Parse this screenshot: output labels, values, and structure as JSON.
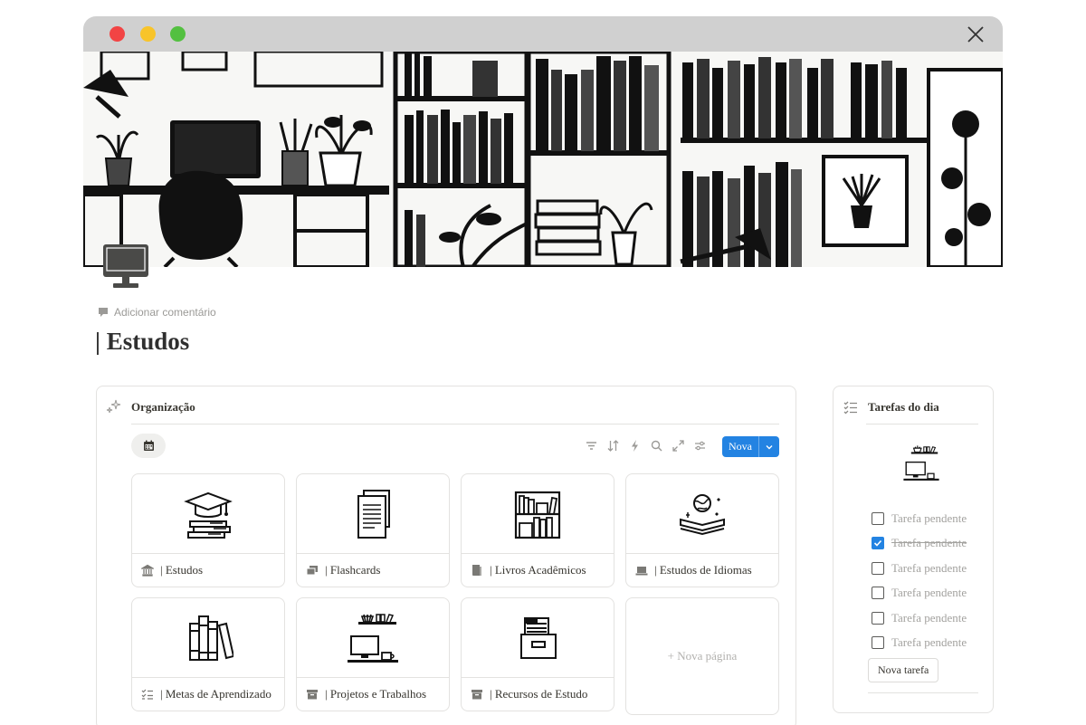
{
  "window": {
    "close_icon": "close-icon"
  },
  "page": {
    "add_comment_label": "Adicionar comentário",
    "title": "| Estudos"
  },
  "organization": {
    "title": "Organização",
    "new_button_label": "Nova",
    "cards": [
      {
        "label": "| Estudos",
        "icon": "bank-icon"
      },
      {
        "label": "| Flashcards",
        "icon": "cards-icon"
      },
      {
        "label": "| Livros Acadêmicos",
        "icon": "book-icon"
      },
      {
        "label": "| Estudos de Idiomas",
        "icon": "laptop-icon"
      },
      {
        "label": "| Metas de Aprendizado",
        "icon": "checklist-icon"
      },
      {
        "label": "| Projetos e Trabalhos",
        "icon": "archive-icon"
      },
      {
        "label": "| Recursos de Estudo",
        "icon": "archive-icon"
      }
    ],
    "new_page_label": "+ Nova página"
  },
  "tasks": {
    "title": "Tarefas do dia",
    "items": [
      {
        "text": "Tarefa pendente",
        "checked": false
      },
      {
        "text": "Tarefa pendente",
        "checked": true
      },
      {
        "text": "Tarefa pendente",
        "checked": false
      },
      {
        "text": "Tarefa pendente",
        "checked": false
      },
      {
        "text": "Tarefa pendente",
        "checked": false
      },
      {
        "text": "Tarefa pendente",
        "checked": false
      }
    ],
    "new_task_label": "Nova tarefa"
  },
  "colors": {
    "accent": "#2383e2",
    "titlebar": "#d0d0d0"
  }
}
